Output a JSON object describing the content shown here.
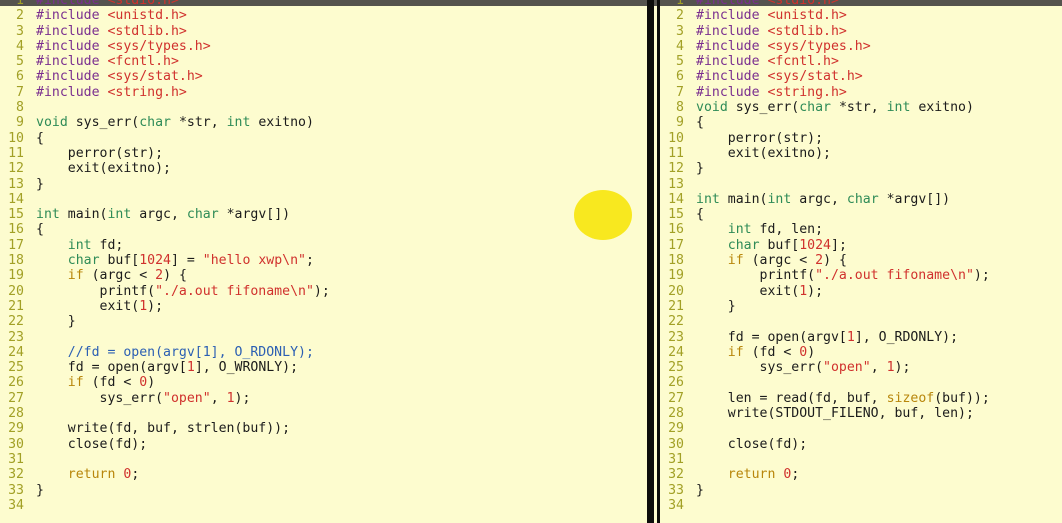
{
  "colors": {
    "background": "#fdfccf",
    "top_bar": "#55534e",
    "divider": "#0d0d0b",
    "line_number": "#a2a026",
    "keyword": "#b8860b",
    "type": "#2e8b57",
    "string": "#d0312d",
    "comment": "#2b5fb3",
    "highlight_marker": "#f8e81f"
  },
  "left_pane": {
    "lines": [
      {
        "n": "1",
        "t": [
          [
            "pp",
            "#include "
          ],
          [
            "str",
            "<stdio.h>"
          ]
        ]
      },
      {
        "n": "2",
        "t": [
          [
            "pp",
            "#include "
          ],
          [
            "str",
            "<unistd.h>"
          ]
        ]
      },
      {
        "n": "3",
        "t": [
          [
            "pp",
            "#include "
          ],
          [
            "str",
            "<stdlib.h>"
          ]
        ]
      },
      {
        "n": "4",
        "t": [
          [
            "pp",
            "#include "
          ],
          [
            "str",
            "<sys/types.h>"
          ]
        ]
      },
      {
        "n": "5",
        "t": [
          [
            "pp",
            "#include "
          ],
          [
            "str",
            "<fcntl.h>"
          ]
        ]
      },
      {
        "n": "6",
        "t": [
          [
            "pp",
            "#include "
          ],
          [
            "str",
            "<sys/stat.h>"
          ]
        ]
      },
      {
        "n": "7",
        "t": [
          [
            "pp",
            "#include "
          ],
          [
            "str",
            "<string.h>"
          ]
        ]
      },
      {
        "n": "8",
        "t": []
      },
      {
        "n": "9",
        "t": [
          [
            "type",
            "void"
          ],
          [
            "fn",
            " sys_err("
          ],
          [
            "type",
            "char"
          ],
          [
            "fn",
            " *str, "
          ],
          [
            "type",
            "int"
          ],
          [
            "fn",
            " exitno)"
          ]
        ]
      },
      {
        "n": "10",
        "t": [
          [
            "fn",
            "{"
          ]
        ]
      },
      {
        "n": "11",
        "t": [
          [
            "fn",
            "    perror(str);"
          ]
        ]
      },
      {
        "n": "12",
        "t": [
          [
            "fn",
            "    exit(exitno);"
          ]
        ]
      },
      {
        "n": "13",
        "t": [
          [
            "fn",
            "}"
          ]
        ]
      },
      {
        "n": "14",
        "t": []
      },
      {
        "n": "15",
        "t": [
          [
            "type",
            "int"
          ],
          [
            "fn",
            " main("
          ],
          [
            "type",
            "int"
          ],
          [
            "fn",
            " argc, "
          ],
          [
            "type",
            "char"
          ],
          [
            "fn",
            " *argv[])"
          ]
        ]
      },
      {
        "n": "16",
        "t": [
          [
            "fn",
            "{"
          ]
        ]
      },
      {
        "n": "17",
        "t": [
          [
            "fn",
            "    "
          ],
          [
            "type",
            "int"
          ],
          [
            "fn",
            " fd;"
          ]
        ]
      },
      {
        "n": "18",
        "t": [
          [
            "fn",
            "    "
          ],
          [
            "type",
            "char"
          ],
          [
            "fn",
            " buf["
          ],
          [
            "num",
            "1024"
          ],
          [
            "fn",
            "] = "
          ],
          [
            "str",
            "\"hello xwp\\n\""
          ],
          [
            "fn",
            ";"
          ]
        ]
      },
      {
        "n": "19",
        "t": [
          [
            "fn",
            "    "
          ],
          [
            "kw",
            "if"
          ],
          [
            "fn",
            " (argc < "
          ],
          [
            "num",
            "2"
          ],
          [
            "fn",
            ") {"
          ]
        ]
      },
      {
        "n": "20",
        "t": [
          [
            "fn",
            "        printf("
          ],
          [
            "str",
            "\"./a.out fifoname\\n\""
          ],
          [
            "fn",
            ");"
          ]
        ]
      },
      {
        "n": "21",
        "t": [
          [
            "fn",
            "        exit("
          ],
          [
            "num",
            "1"
          ],
          [
            "fn",
            ");"
          ]
        ]
      },
      {
        "n": "22",
        "t": [
          [
            "fn",
            "    }"
          ]
        ]
      },
      {
        "n": "23",
        "t": []
      },
      {
        "n": "24",
        "t": [
          [
            "cmt",
            "    //fd = open(argv[1], O_RDONLY);"
          ]
        ]
      },
      {
        "n": "25",
        "t": [
          [
            "fn",
            "    fd = open(argv["
          ],
          [
            "num",
            "1"
          ],
          [
            "fn",
            "], O_WRONLY);"
          ]
        ]
      },
      {
        "n": "26",
        "t": [
          [
            "fn",
            "    "
          ],
          [
            "kw",
            "if"
          ],
          [
            "fn",
            " (fd < "
          ],
          [
            "num",
            "0"
          ],
          [
            "fn",
            ")"
          ]
        ]
      },
      {
        "n": "27",
        "t": [
          [
            "fn",
            "        sys_err("
          ],
          [
            "str",
            "\"open\""
          ],
          [
            "fn",
            ", "
          ],
          [
            "num",
            "1"
          ],
          [
            "fn",
            ");"
          ]
        ]
      },
      {
        "n": "28",
        "t": []
      },
      {
        "n": "29",
        "t": [
          [
            "fn",
            "    write(fd, buf, strlen(buf));"
          ]
        ]
      },
      {
        "n": "30",
        "t": [
          [
            "fn",
            "    close(fd);"
          ]
        ]
      },
      {
        "n": "31",
        "t": []
      },
      {
        "n": "32",
        "t": [
          [
            "fn",
            "    "
          ],
          [
            "kw",
            "return"
          ],
          [
            "fn",
            " "
          ],
          [
            "num",
            "0"
          ],
          [
            "fn",
            ";"
          ]
        ]
      },
      {
        "n": "33",
        "t": [
          [
            "fn",
            "}"
          ]
        ]
      },
      {
        "n": "34",
        "t": []
      }
    ]
  },
  "right_pane": {
    "lines": [
      {
        "n": "1",
        "t": [
          [
            "pp",
            "#include "
          ],
          [
            "str",
            "<stdio.h>"
          ]
        ]
      },
      {
        "n": "2",
        "t": [
          [
            "pp",
            "#include "
          ],
          [
            "str",
            "<unistd.h>"
          ]
        ]
      },
      {
        "n": "3",
        "t": [
          [
            "pp",
            "#include "
          ],
          [
            "str",
            "<stdlib.h>"
          ]
        ]
      },
      {
        "n": "4",
        "t": [
          [
            "pp",
            "#include "
          ],
          [
            "str",
            "<sys/types.h>"
          ]
        ]
      },
      {
        "n": "5",
        "t": [
          [
            "pp",
            "#include "
          ],
          [
            "str",
            "<fcntl.h>"
          ]
        ]
      },
      {
        "n": "6",
        "t": [
          [
            "pp",
            "#include "
          ],
          [
            "str",
            "<sys/stat.h>"
          ]
        ]
      },
      {
        "n": "7",
        "t": [
          [
            "pp",
            "#include "
          ],
          [
            "str",
            "<string.h>"
          ]
        ]
      },
      {
        "n": "8",
        "t": [
          [
            "type",
            "void"
          ],
          [
            "fn",
            " sys_err("
          ],
          [
            "type",
            "char"
          ],
          [
            "fn",
            " *str, "
          ],
          [
            "type",
            "int"
          ],
          [
            "fn",
            " exitno)"
          ]
        ]
      },
      {
        "n": "9",
        "t": [
          [
            "fn",
            "{"
          ]
        ]
      },
      {
        "n": "10",
        "t": [
          [
            "fn",
            "    perror(str);"
          ]
        ]
      },
      {
        "n": "11",
        "t": [
          [
            "fn",
            "    exit(exitno);"
          ]
        ]
      },
      {
        "n": "12",
        "t": [
          [
            "fn",
            "}"
          ]
        ]
      },
      {
        "n": "13",
        "t": []
      },
      {
        "n": "14",
        "t": [
          [
            "type",
            "int"
          ],
          [
            "fn",
            " main("
          ],
          [
            "type",
            "int"
          ],
          [
            "fn",
            " argc, "
          ],
          [
            "type",
            "char"
          ],
          [
            "fn",
            " *argv[])"
          ]
        ]
      },
      {
        "n": "15",
        "t": [
          [
            "fn",
            "{"
          ]
        ]
      },
      {
        "n": "16",
        "t": [
          [
            "fn",
            "    "
          ],
          [
            "type",
            "int"
          ],
          [
            "fn",
            " fd, len;"
          ]
        ]
      },
      {
        "n": "17",
        "t": [
          [
            "fn",
            "    "
          ],
          [
            "type",
            "char"
          ],
          [
            "fn",
            " buf["
          ],
          [
            "num",
            "1024"
          ],
          [
            "fn",
            "];"
          ]
        ]
      },
      {
        "n": "18",
        "t": [
          [
            "fn",
            "    "
          ],
          [
            "kw",
            "if"
          ],
          [
            "fn",
            " (argc < "
          ],
          [
            "num",
            "2"
          ],
          [
            "fn",
            ") {"
          ]
        ]
      },
      {
        "n": "19",
        "t": [
          [
            "fn",
            "        printf("
          ],
          [
            "str",
            "\"./a.out fifoname\\n\""
          ],
          [
            "fn",
            ");"
          ]
        ]
      },
      {
        "n": "20",
        "t": [
          [
            "fn",
            "        exit("
          ],
          [
            "num",
            "1"
          ],
          [
            "fn",
            ");"
          ]
        ]
      },
      {
        "n": "21",
        "t": [
          [
            "fn",
            "    }"
          ]
        ]
      },
      {
        "n": "22",
        "t": []
      },
      {
        "n": "23",
        "t": [
          [
            "fn",
            "    fd = open(argv["
          ],
          [
            "num",
            "1"
          ],
          [
            "fn",
            "], O_RDONLY);"
          ]
        ]
      },
      {
        "n": "24",
        "t": [
          [
            "fn",
            "    "
          ],
          [
            "kw",
            "if"
          ],
          [
            "fn",
            " (fd < "
          ],
          [
            "num",
            "0"
          ],
          [
            "fn",
            ")"
          ]
        ]
      },
      {
        "n": "25",
        "t": [
          [
            "fn",
            "        sys_err("
          ],
          [
            "str",
            "\"open\""
          ],
          [
            "fn",
            ", "
          ],
          [
            "num",
            "1"
          ],
          [
            "fn",
            ");"
          ]
        ]
      },
      {
        "n": "26",
        "t": []
      },
      {
        "n": "27",
        "t": [
          [
            "fn",
            "    len = read(fd, buf, "
          ],
          [
            "kw",
            "sizeof"
          ],
          [
            "fn",
            "(buf));"
          ]
        ]
      },
      {
        "n": "28",
        "t": [
          [
            "fn",
            "    write(STDOUT_FILENO, buf, len);"
          ]
        ]
      },
      {
        "n": "29",
        "t": []
      },
      {
        "n": "30",
        "t": [
          [
            "fn",
            "    close(fd);"
          ]
        ]
      },
      {
        "n": "31",
        "t": []
      },
      {
        "n": "32",
        "t": [
          [
            "fn",
            "    "
          ],
          [
            "kw",
            "return"
          ],
          [
            "fn",
            " "
          ],
          [
            "num",
            "0"
          ],
          [
            "fn",
            ";"
          ]
        ]
      },
      {
        "n": "33",
        "t": [
          [
            "fn",
            "}"
          ]
        ]
      },
      {
        "n": "34",
        "t": []
      }
    ]
  }
}
